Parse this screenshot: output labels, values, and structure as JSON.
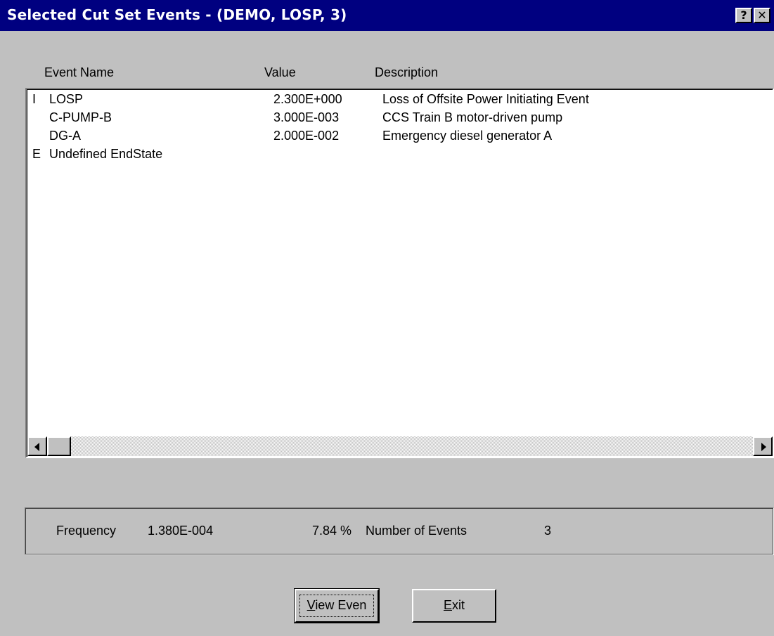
{
  "window": {
    "title": "Selected Cut Set Events  -  (DEMO, LOSP, 3)",
    "help_label": "?",
    "close_label": "✕"
  },
  "columns": {
    "event_name": "Event Name",
    "value": "Value",
    "description": "Description"
  },
  "events": [
    {
      "flag": "I",
      "name": "LOSP",
      "value": "2.300E+000",
      "description": "Loss of Offsite Power Initiating Event"
    },
    {
      "flag": "",
      "name": "C-PUMP-B",
      "value": "3.000E-003",
      "description": "CCS Train B motor-driven pump"
    },
    {
      "flag": "",
      "name": "DG-A",
      "value": "2.000E-002",
      "description": "Emergency diesel generator A"
    },
    {
      "flag": "E",
      "name": "Undefined EndState",
      "value": "",
      "description": ""
    }
  ],
  "summary": {
    "frequency_label": "Frequency",
    "frequency_value": "1.380E-004",
    "percent": "7.84 %",
    "num_events_label": "Number of Events",
    "num_events_value": "3"
  },
  "buttons": {
    "view_first": "V",
    "view_rest": "iew Even",
    "exit_first": "E",
    "exit_rest": "xit"
  }
}
